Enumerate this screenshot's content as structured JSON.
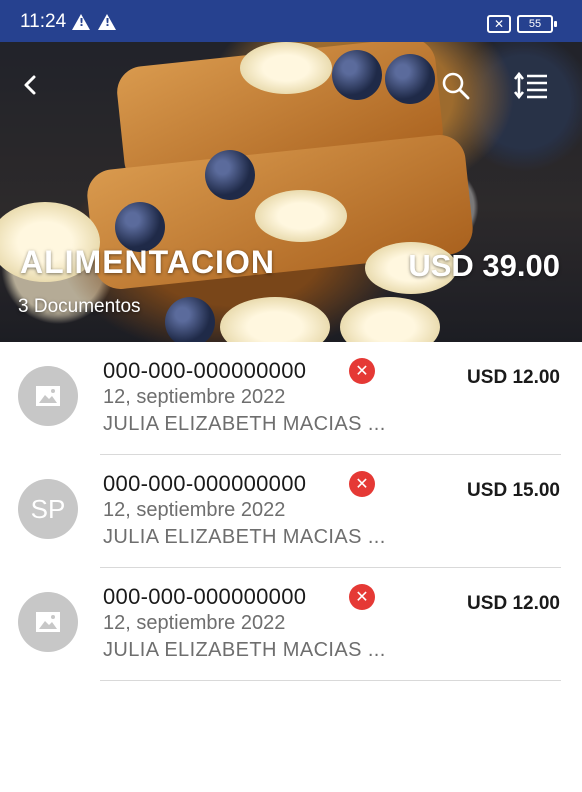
{
  "status_bar": {
    "time": "11:24",
    "battery": "55",
    "icons": [
      "warning-icon",
      "warning-icon",
      "sim-error-icon",
      "battery-icon"
    ]
  },
  "header": {
    "title": "ALIMENTACION",
    "document_count": "3 Documentos",
    "total": "USD 39.00",
    "icons": [
      "back-icon",
      "search-icon",
      "sort-icon"
    ]
  },
  "documents": [
    {
      "avatar_type": "image-placeholder-icon",
      "avatar_text": "",
      "number": "000-000-000000000",
      "date": "12, septiembre 2022",
      "person": "JULIA ELIZABETH MACIAS ...",
      "amount": "USD 12.00",
      "status_icon": "error-icon"
    },
    {
      "avatar_type": "initials",
      "avatar_text": "SP",
      "number": "000-000-000000000",
      "date": "12, septiembre 2022",
      "person": "JULIA ELIZABETH MACIAS ...",
      "amount": "USD 15.00",
      "status_icon": "error-icon"
    },
    {
      "avatar_type": "image-placeholder-icon",
      "avatar_text": "",
      "number": "000-000-000000000",
      "date": "12, septiembre 2022",
      "person": "JULIA ELIZABETH MACIAS ...",
      "amount": "USD 12.00",
      "status_icon": "error-icon"
    }
  ],
  "colors": {
    "status_bar": "#26418f",
    "error": "#e53935",
    "avatar": "#c7c7c7",
    "secondary_text": "#6e6e6e"
  }
}
